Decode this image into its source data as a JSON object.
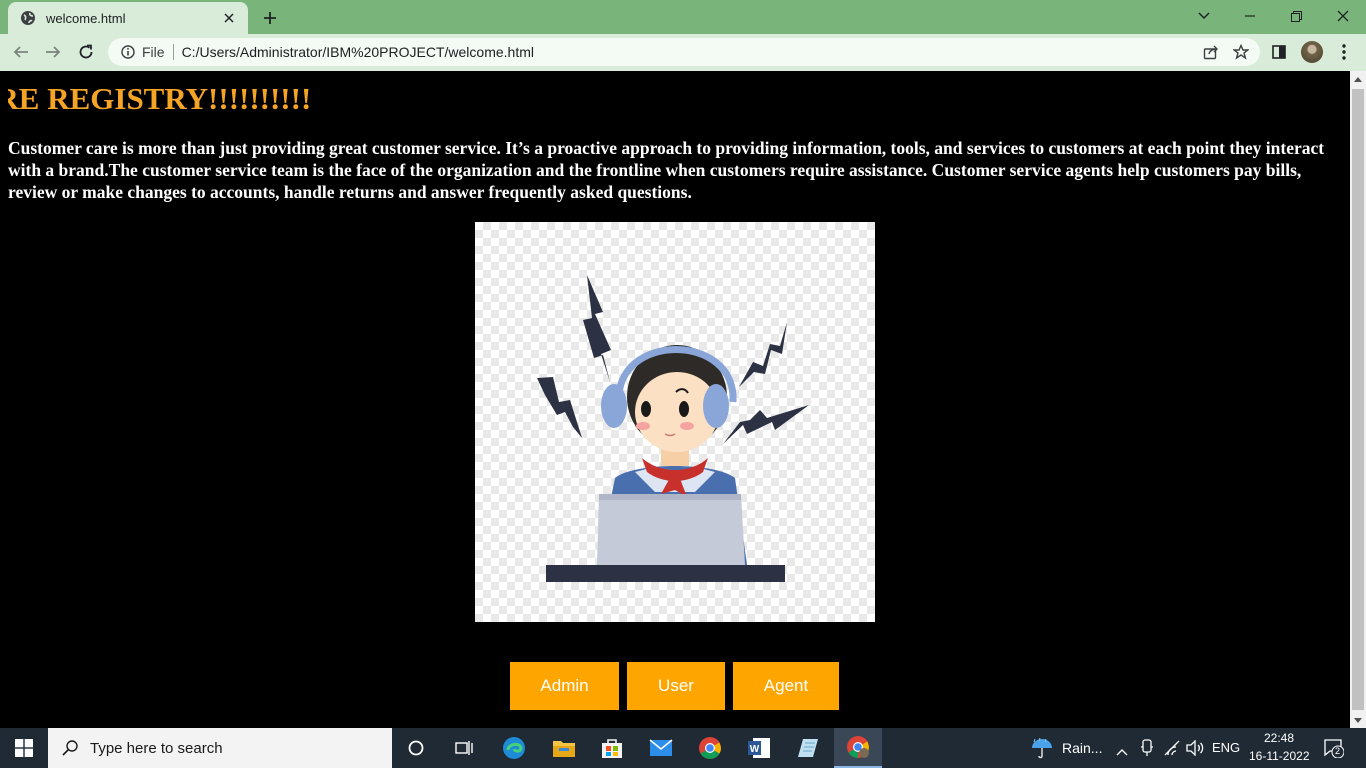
{
  "browser": {
    "tab_title": "welcome.html",
    "omnibox_scheme": "File",
    "url": "C:/Users/Administrator/IBM%20PROJECT/welcome.html",
    "colors": {
      "frame": "#79b57a",
      "toolbar": "#d9ecd9"
    }
  },
  "page": {
    "marquee_title": "ARE REGISTRY!!!!!!!!!!",
    "intro": "Customer care is more than just providing great customer service. It’s a proactive approach to providing information, tools, and services to customers at each point they interact with a brand.The customer service team is the face of the organization and the frontline when customers require assistance. Customer service agents help customers pay bills, review or make changes to accounts, handle returns and answer frequently asked questions.",
    "hero_image_icon": "customer-care-agent-illustration",
    "buttons": {
      "admin": "Admin",
      "user": "User",
      "agent": "Agent"
    },
    "colors": {
      "background": "#000000",
      "title": "#f5a425",
      "button": "#ffa500",
      "text": "#ffffff"
    }
  },
  "taskbar": {
    "search_placeholder": "Type here to search",
    "weather": "Rain...",
    "language": "ENG",
    "time": "22:48",
    "date": "16-11-2022",
    "notification_count": "2"
  }
}
